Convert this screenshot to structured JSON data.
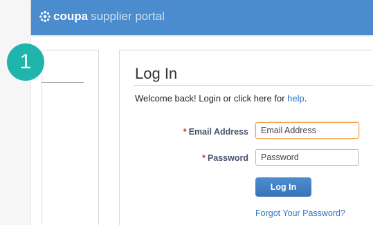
{
  "header": {
    "brand": "coupa",
    "subtitle": "supplier portal",
    "color": "#4a8ccd"
  },
  "step_badge": {
    "number": "1",
    "color": "#1fb4ac"
  },
  "login": {
    "title": "Log In",
    "welcome_prefix": "Welcome back! Login or click here for ",
    "help_link": "help",
    "welcome_suffix": ".",
    "email": {
      "required_mark": "*",
      "label": "Email Address",
      "placeholder": "Email Address",
      "value": ""
    },
    "password": {
      "required_mark": "*",
      "label": "Password",
      "placeholder": "Password",
      "value": ""
    },
    "submit_label": "Log In",
    "forgot_link": "Forgot Your Password?"
  },
  "colors": {
    "accent": "#3873b8",
    "link": "#2f72c4",
    "required": "#d8352a",
    "focus": "#f0a24d"
  }
}
